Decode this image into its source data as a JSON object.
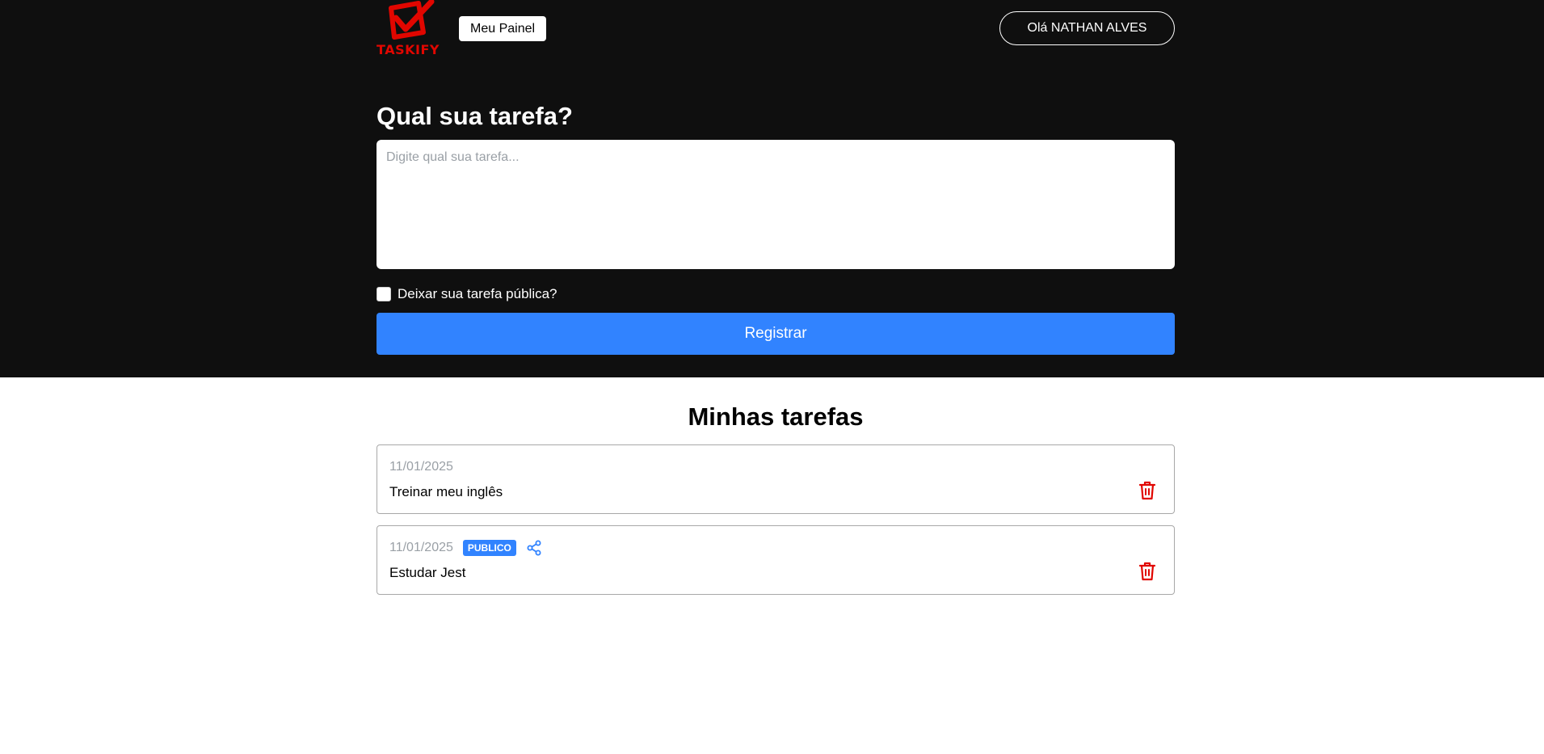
{
  "header": {
    "logo_text": "TASKIFY",
    "panel_label": "Meu Painel",
    "user_greeting": "Olá NATHAN ALVES"
  },
  "form": {
    "title": "Qual sua tarefa?",
    "placeholder": "Digite qual sua tarefa...",
    "public_label": "Deixar sua tarefa pública?",
    "public_checked": false,
    "submit_label": "Registrar"
  },
  "tasks": {
    "title": "Minhas tarefas",
    "items": [
      {
        "date": "11/01/2025",
        "text": "Treinar meu inglês",
        "public": false
      },
      {
        "date": "11/01/2025",
        "text": "Estudar Jest",
        "public": true,
        "badge": "PUBLICO"
      }
    ]
  },
  "icons": {
    "logo": "checkbox-check-icon",
    "share": "share-icon",
    "delete": "trash-icon"
  },
  "colors": {
    "header_bg": "#0f0f0f",
    "accent": "#3183ff",
    "danger": "#e10600"
  }
}
